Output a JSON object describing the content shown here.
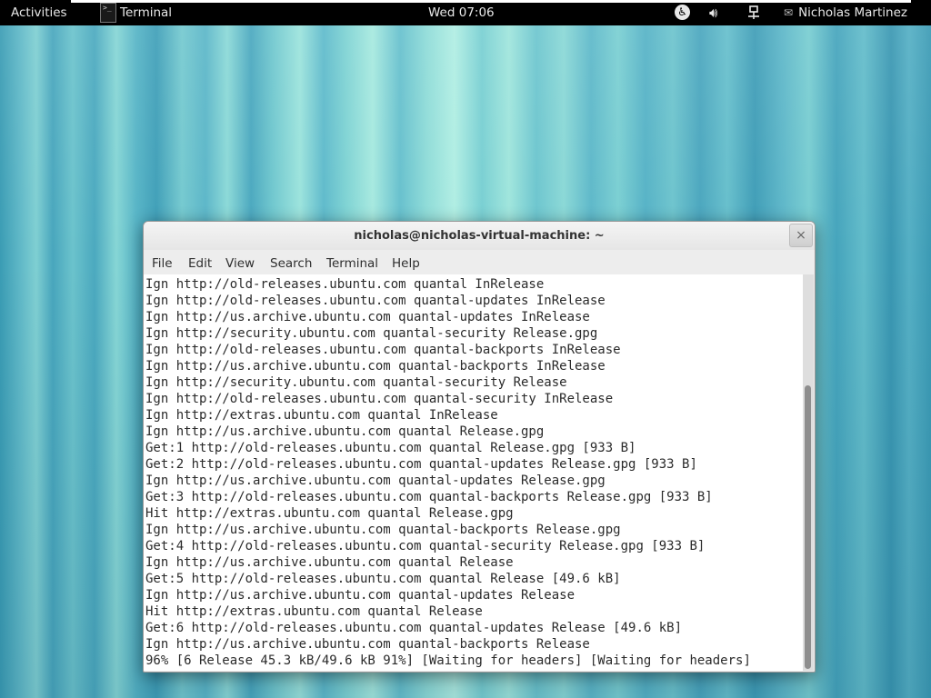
{
  "top_bar": {
    "activities": "Activities",
    "app_menu": {
      "icon": "terminal-icon",
      "label": "Terminal"
    },
    "clock": "Wed 07:06",
    "status_icons": [
      "accessibility-icon",
      "volume-icon",
      "network-icon"
    ],
    "user": "Nicholas Martinez"
  },
  "window": {
    "title": "nicholas@nicholas-virtual-machine: ~",
    "close_symbol": "×",
    "menu": {
      "file": "File",
      "edit": "Edit",
      "view": "View",
      "search": "Search",
      "terminal": "Terminal",
      "help": "Help"
    },
    "output": "Ign http://old-releases.ubuntu.com quantal InRelease\nIgn http://old-releases.ubuntu.com quantal-updates InRelease\nIgn http://us.archive.ubuntu.com quantal-updates InRelease\nIgn http://security.ubuntu.com quantal-security Release.gpg\nIgn http://old-releases.ubuntu.com quantal-backports InRelease\nIgn http://us.archive.ubuntu.com quantal-backports InRelease\nIgn http://security.ubuntu.com quantal-security Release\nIgn http://old-releases.ubuntu.com quantal-security InRelease\nIgn http://extras.ubuntu.com quantal InRelease\nIgn http://us.archive.ubuntu.com quantal Release.gpg\nGet:1 http://old-releases.ubuntu.com quantal Release.gpg [933 B]\nGet:2 http://old-releases.ubuntu.com quantal-updates Release.gpg [933 B]\nIgn http://us.archive.ubuntu.com quantal-updates Release.gpg\nGet:3 http://old-releases.ubuntu.com quantal-backports Release.gpg [933 B]\nHit http://extras.ubuntu.com quantal Release.gpg\nIgn http://us.archive.ubuntu.com quantal-backports Release.gpg\nGet:4 http://old-releases.ubuntu.com quantal-security Release.gpg [933 B]\nIgn http://us.archive.ubuntu.com quantal Release\nGet:5 http://old-releases.ubuntu.com quantal Release [49.6 kB]\nIgn http://us.archive.ubuntu.com quantal-updates Release\nHit http://extras.ubuntu.com quantal Release\nGet:6 http://old-releases.ubuntu.com quantal-updates Release [49.6 kB]\nIgn http://us.archive.ubuntu.com quantal-backports Release\n96% [6 Release 45.3 kB/49.6 kB 91%] [Waiting for headers] [Waiting for headers]"
  },
  "colors": {
    "top_bar_bg": "#000000",
    "terminal_bg": "#ffffff",
    "window_chrome": "#ededed"
  }
}
